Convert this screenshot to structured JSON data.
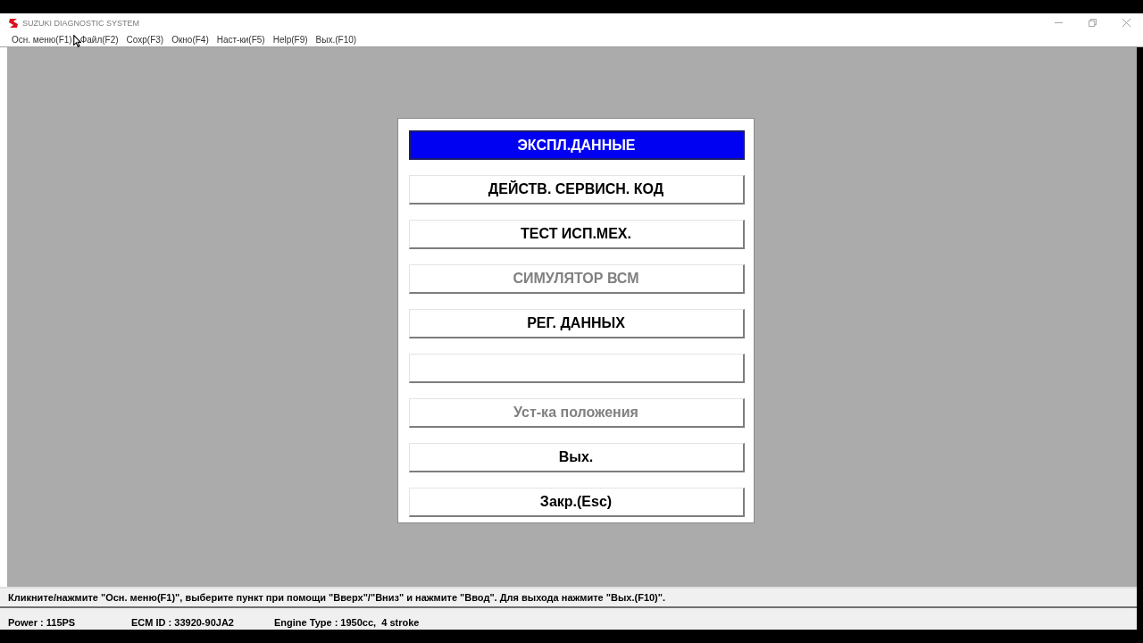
{
  "window": {
    "title": "SUZUKI DIAGNOSTIC SYSTEM"
  },
  "menu": [
    "Осн. меню(F1)",
    "Файл(F2)",
    "Сохр(F3)",
    "Окно(F4)",
    "Наст-ки(F5)",
    "Help(F9)",
    "Вых.(F10)"
  ],
  "dialog": {
    "buttons": [
      {
        "label": "ЭКСПЛ.ДАННЫЕ",
        "selected": true,
        "disabled": false
      },
      {
        "label": "ДЕЙСТВ. СЕРВИСН. КОД",
        "selected": false,
        "disabled": false
      },
      {
        "label": "ТЕСТ ИСП.МЕХ.",
        "selected": false,
        "disabled": false
      },
      {
        "label": "СИМУЛЯТОР ВСМ",
        "selected": false,
        "disabled": true
      },
      {
        "label": "РЕГ. ДАННЫХ",
        "selected": false,
        "disabled": false
      },
      {
        "selected": false
      },
      {
        "label": "Уст-ка положения",
        "selected": false,
        "disabled": true
      },
      {
        "label": "Вых.",
        "selected": false,
        "disabled": false
      },
      {
        "label": "Закр.(Esc)",
        "selected": false,
        "disabled": false
      }
    ]
  },
  "status_bar": {
    "hint": "Кликните/нажмите \"Осн. меню(F1)\", выберите пункт при помощи \"Вверх\"/\"Вниз\" и нажмите \"Ввод\". Для выхода нажмите \"Вых.(F10)\".",
    "fields": [
      "Power : 115PS",
      "ECM ID : 33920-90JA2",
      "Engine Type : 1950cc,  4 stroke"
    ]
  }
}
